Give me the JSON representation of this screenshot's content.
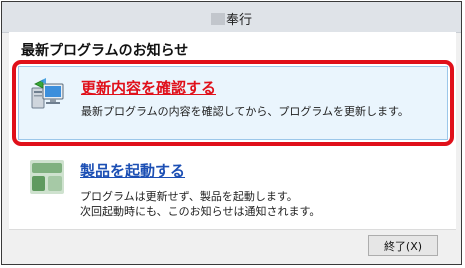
{
  "window": {
    "title": "奉行"
  },
  "dialog": {
    "heading": "最新プログラムのお知らせ",
    "options": [
      {
        "title": "更新内容を確認する",
        "description": "最新プログラムの内容を確認してから、プログラムを更新します。",
        "icon": "computer-update-icon",
        "highlighted": true,
        "title_color": "#e0101a"
      },
      {
        "title": "製品を起動する",
        "description_lines": [
          "プログラムは更新せず、製品を起動します。",
          "次回起動時にも、このお知らせは通知されます。"
        ],
        "icon": "product-app-icon",
        "highlighted": false,
        "title_color": "#1c4fb4"
      }
    ]
  },
  "footer": {
    "close_label": "終了(X)"
  },
  "colors": {
    "highlight_border": "#e0101a",
    "selected_option_bg": "#eaf5fd",
    "link_blue": "#1c4fb4"
  }
}
